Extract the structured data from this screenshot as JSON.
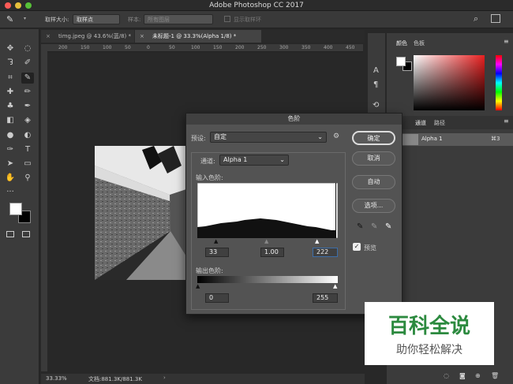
{
  "app": {
    "title": "Adobe Photoshop CC 2017"
  },
  "options_bar": {
    "sample_size_label": "取样大小:",
    "sample_size_value": "取样点",
    "sample_label": "样本:",
    "sample_value": "所有图层",
    "show_ring_label": "显示取样环"
  },
  "tabs": [
    {
      "label": "timg.jpeg @ 43.6%(蓝/8) *"
    },
    {
      "label": "未标题-1 @ 33.3%(Alpha 1/8) *"
    }
  ],
  "rulers": {
    "top": [
      "200",
      "150",
      "100",
      "50",
      "0",
      "50",
      "100",
      "150",
      "200",
      "250",
      "300",
      "350",
      "400",
      "450"
    ]
  },
  "status": {
    "zoom": "33.33%",
    "doc": "文档:881.3K/881.3K"
  },
  "panels": {
    "color_tab": "颜色",
    "swatches_tab": "色板",
    "channels_tabs": [
      "通道",
      "路径"
    ],
    "channel_name": "Alpha 1",
    "channel_shortcut": "⌘3"
  },
  "levels_dialog": {
    "title": "色阶",
    "preset_label": "预设:",
    "preset_value": "自定",
    "channel_label": "通道:",
    "channel_value": "Alpha 1",
    "input_label": "输入色阶:",
    "input_values": [
      "33",
      "1.00",
      "222"
    ],
    "output_label": "输出色阶:",
    "output_values": [
      "0",
      "255"
    ],
    "buttons": {
      "ok": "确定",
      "cancel": "取消",
      "auto": "自动",
      "options": "选项..."
    },
    "preview_label": "预览",
    "preview_checked": true
  },
  "watermark": {
    "title": "百科全说",
    "subtitle": "助你轻松解决"
  },
  "colors": {
    "accent_blue": "#3d6ea8",
    "watermark_green": "#2c8a3f"
  }
}
